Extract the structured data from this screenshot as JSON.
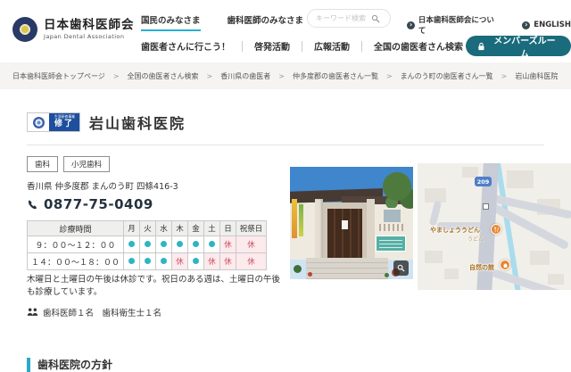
{
  "header": {
    "logo": {
      "title": "日本歯科医師会",
      "subtitle": "Japan Dental Association"
    },
    "nav_top": [
      {
        "label": "国民のみなさま",
        "active": true
      },
      {
        "label": "歯科医師のみなさま",
        "active": false
      }
    ],
    "search": {
      "placeholder": "キーワード検索"
    },
    "utility_links": [
      {
        "label": "日本歯科医師会について"
      },
      {
        "label": "ENGLISH"
      }
    ],
    "nav_main": [
      "歯医者さんに行こう！",
      "啓発活動",
      "広報活動",
      "全国の歯医者さん検索"
    ],
    "members_button": {
      "label": "メンバーズルーム"
    }
  },
  "breadcrumb": [
    "日本歯科医師会トップページ",
    "全国の歯医者さん検索",
    "香川県の歯医者",
    "仲多度郡の歯医者さん一覧",
    "まんのう町の歯医者さん一覧",
    "岩山歯科医院"
  ],
  "clinic": {
    "badge": {
      "line1": "生涯研修事業",
      "line2": "修了"
    },
    "name": "岩山歯科医院",
    "tags": [
      "歯科",
      "小児歯科"
    ],
    "address": "香川県 仲多度郡 まんのう町 四條416-3",
    "phone": "0877-75-0409",
    "schedule": {
      "header": [
        "診療時間",
        "月",
        "火",
        "水",
        "木",
        "金",
        "土",
        "日",
        "祝祭日"
      ],
      "rows": [
        {
          "time": "９：００～１２：００",
          "cells": [
            "open",
            "open",
            "open",
            "open",
            "open",
            "open",
            "closed",
            "closed"
          ]
        },
        {
          "time": "１４：００～１８：００",
          "cells": [
            "open",
            "open",
            "open",
            "closed",
            "open",
            "closed",
            "closed",
            "closed"
          ]
        }
      ],
      "closed_label": "休"
    },
    "note": "木曜日と土曜日の午後は休診です。祝日のある週は、土曜日の午後も診療しています。",
    "staff": "歯科医師１名　歯科衛生士１名"
  },
  "map": {
    "route_shield": "209",
    "pois": [
      {
        "name": "やましょううどん",
        "sub": "うどん"
      },
      {
        "name": "自然の館"
      }
    ]
  },
  "section": {
    "title": "歯科医院の方針"
  },
  "colors": {
    "accent_teal": "#1a6b7c",
    "active_underline": "#29aed3",
    "open_dot": "#2fb4c4",
    "closed_text": "#c75060",
    "closed_bg": "#fceaed",
    "badge_blue": "#1d4f9e",
    "marker_orange": "#e8872e",
    "section_bar": "#2aa9c9"
  }
}
